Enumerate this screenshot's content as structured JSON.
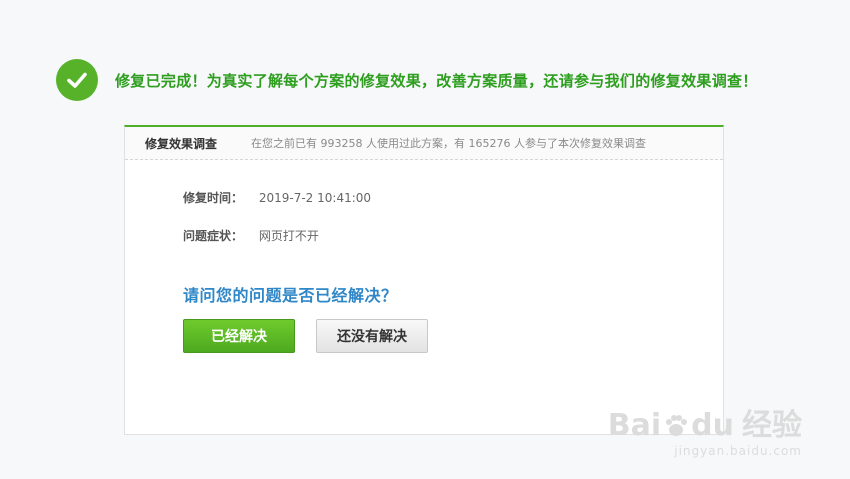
{
  "banner": {
    "icon": "checkmark-icon",
    "text": "修复已完成！为真实了解每个方案的修复效果，改善方案质量，还请参与我们的修复效果调查！"
  },
  "card": {
    "title": "修复效果调查",
    "note": "在您之前已有 993258 人使用过此方案，有 165276 人参与了本次修复效果调查",
    "fields": [
      {
        "label": "修复时间：",
        "value": "2019-7-2 10:41:00"
      },
      {
        "label": "问题症状：",
        "value": "网页打不开"
      }
    ],
    "question": "请问您的问题是否已经解决？",
    "buttons": {
      "yes": "已经解决",
      "no": "还没有解决"
    }
  },
  "watermark": {
    "brand_a": "Bai",
    "brand_b": "du",
    "brand_cn": "经验",
    "url": "jingyan.baidu.com"
  },
  "colors": {
    "accent_green": "#4fae2a",
    "question_blue": "#2f87c8"
  }
}
